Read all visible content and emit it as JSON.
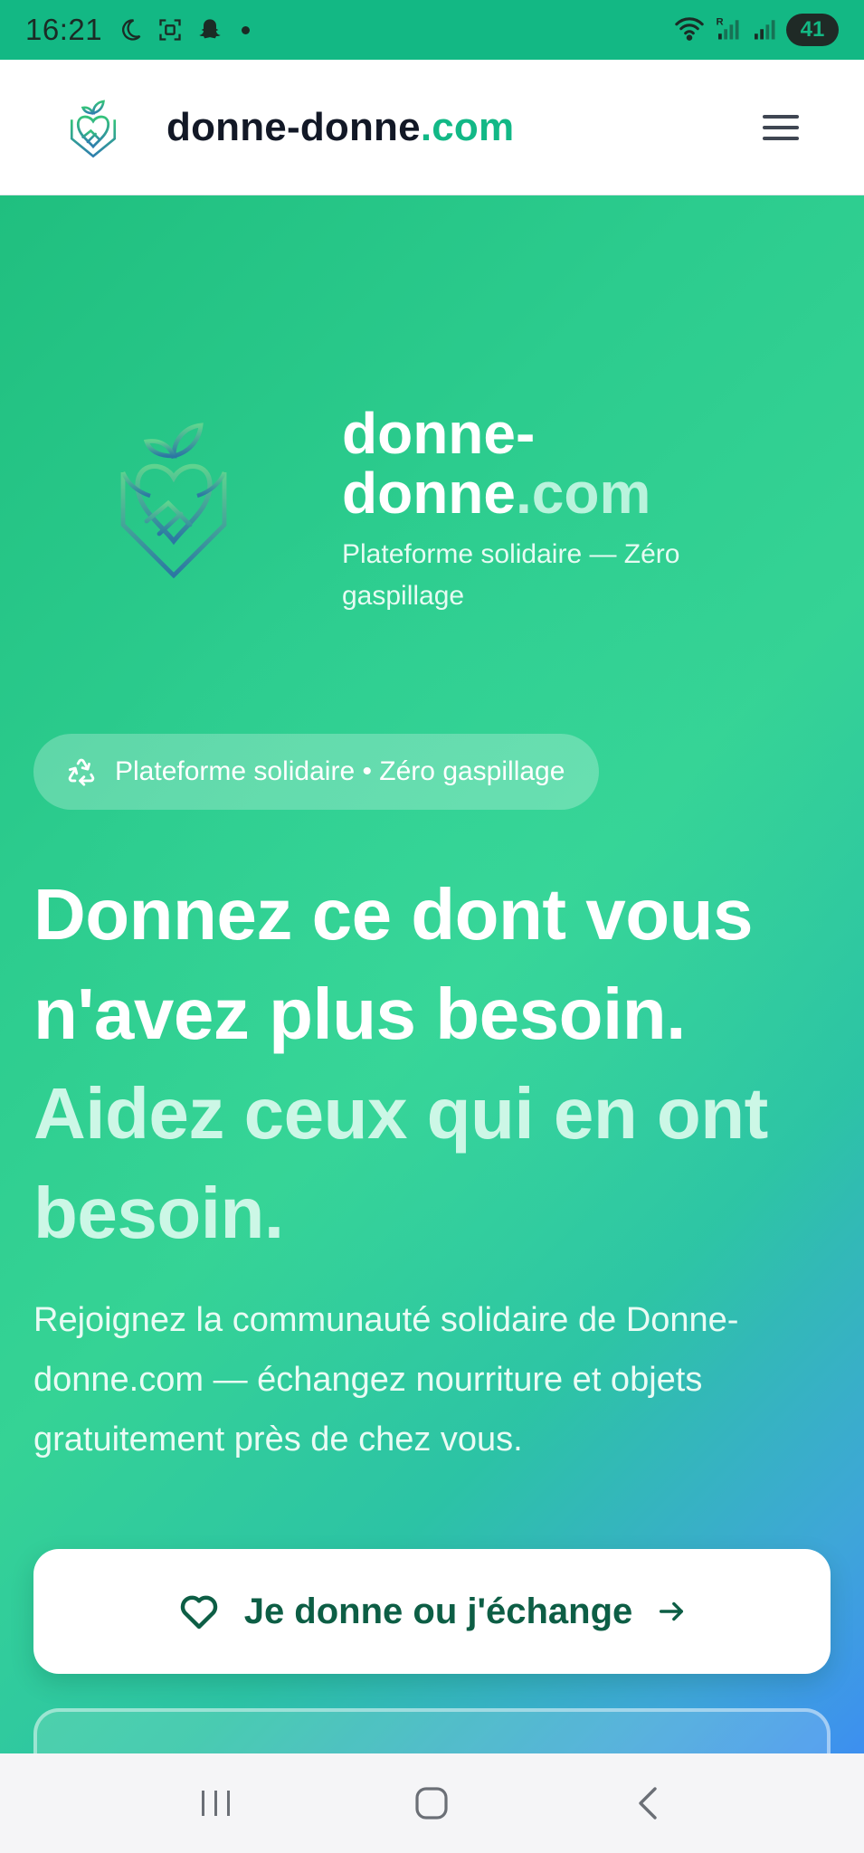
{
  "status_bar": {
    "time": "16:21",
    "battery": "41",
    "icons": [
      "moon-icon",
      "screenshot-icon",
      "snapchat-icon",
      "notification-dot",
      "wifi-icon",
      "signal-roaming-icon",
      "signal-icon",
      "battery-icon"
    ]
  },
  "header": {
    "brand_main": "donne-donne",
    "brand_accent": ".com",
    "menu_icon": "hamburger-menu-icon"
  },
  "hero": {
    "brand_line1": "donne-",
    "brand_line2_main": "donne",
    "brand_line2_accent": ".com",
    "brand_subtitle": "Plateforme solidaire — Zéro gaspillage",
    "pill_text": "Plateforme solidaire • Zéro gaspillage",
    "headline_line1": "Donnez ce dont vous n'avez plus besoin.",
    "headline_line2": "Aidez ceux qui en ont besoin.",
    "lead": "Rejoignez la communauté solidaire de Donne-donne.com — échangez nourriture et objets gratuitement près de chez vous.",
    "cta_label": "Je donne ou j'échange"
  },
  "colors": {
    "accent": "#12b886",
    "cta_text": "#0d5e45",
    "gradient_start": "#20bf7f",
    "gradient_end": "#3d8ff0"
  },
  "nav_bar": {
    "icons": [
      "recent-apps-icon",
      "home-icon",
      "back-icon"
    ]
  }
}
